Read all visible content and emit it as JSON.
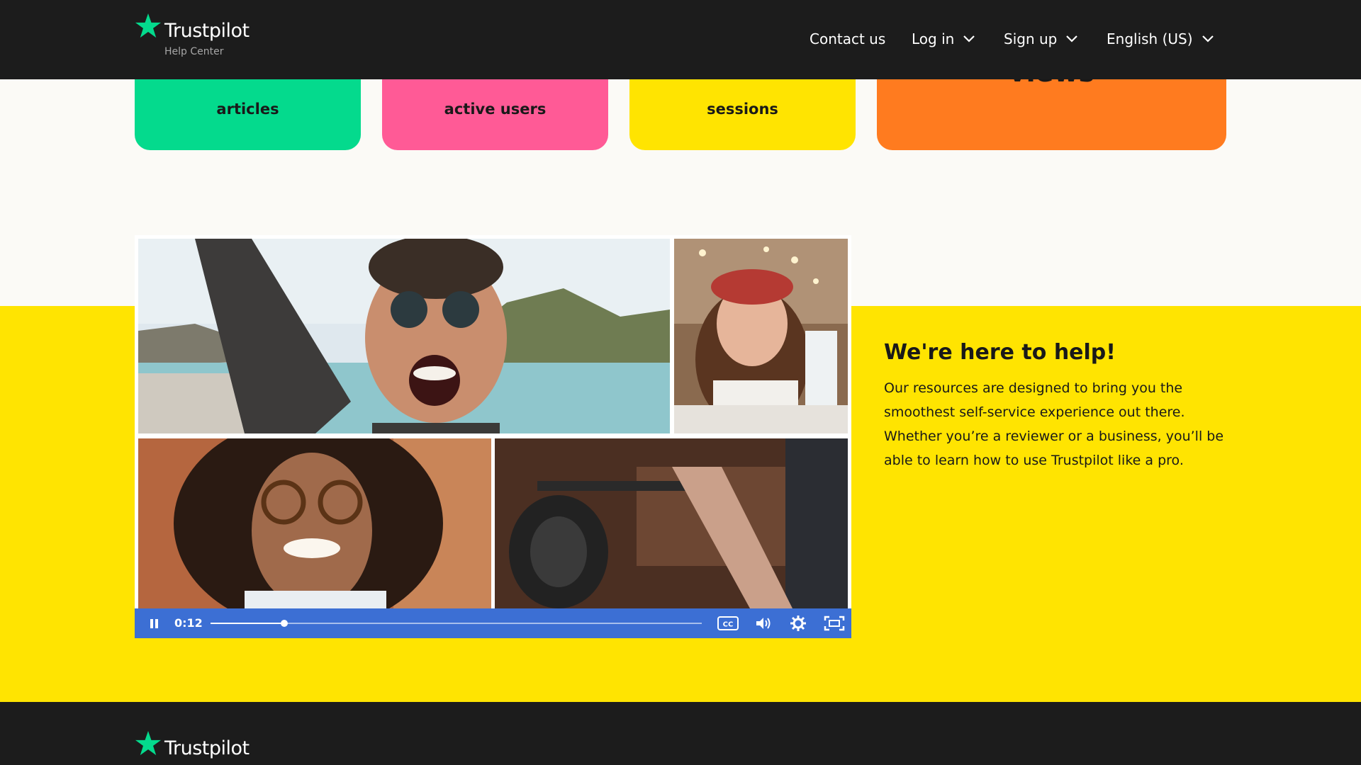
{
  "header": {
    "logo_text": "Trustpilot",
    "logo_sub": "Help Center",
    "nav": [
      {
        "label": "Contact us",
        "icon": ""
      },
      {
        "label": "Log in",
        "icon": "chevron-down-icon"
      },
      {
        "label": "Sign up",
        "icon": "chevron-down-icon"
      },
      {
        "label": "English (US)",
        "icon": "chevron-down-icon"
      }
    ]
  },
  "stats": [
    {
      "label": "articles",
      "color": "#04da8d"
    },
    {
      "label": "active users",
      "color": "#ff5a96"
    },
    {
      "label": "sessions",
      "color": "#ffe401"
    },
    {
      "label": "views",
      "color": "#ff7b1f"
    }
  ],
  "video": {
    "time": "0:12",
    "progress": 0.15,
    "controls": [
      "pause-icon",
      "closed-captions-icon",
      "volume-icon",
      "settings-icon",
      "fullscreen-icon"
    ]
  },
  "help": {
    "title": "We're here to help!",
    "body": "Our resources are designed to bring you the smoothest self-service experience out there. Whether you’re a reviewer or a business, you’ll be able to learn how to use Trustpilot like a pro."
  },
  "footer": {
    "logo_text": "Trustpilot"
  },
  "colors": {
    "header_bg": "#1c1c1c",
    "brand_green": "#04da8d",
    "band_yellow": "#ffe401",
    "player_blue": "#3c6fd4"
  }
}
